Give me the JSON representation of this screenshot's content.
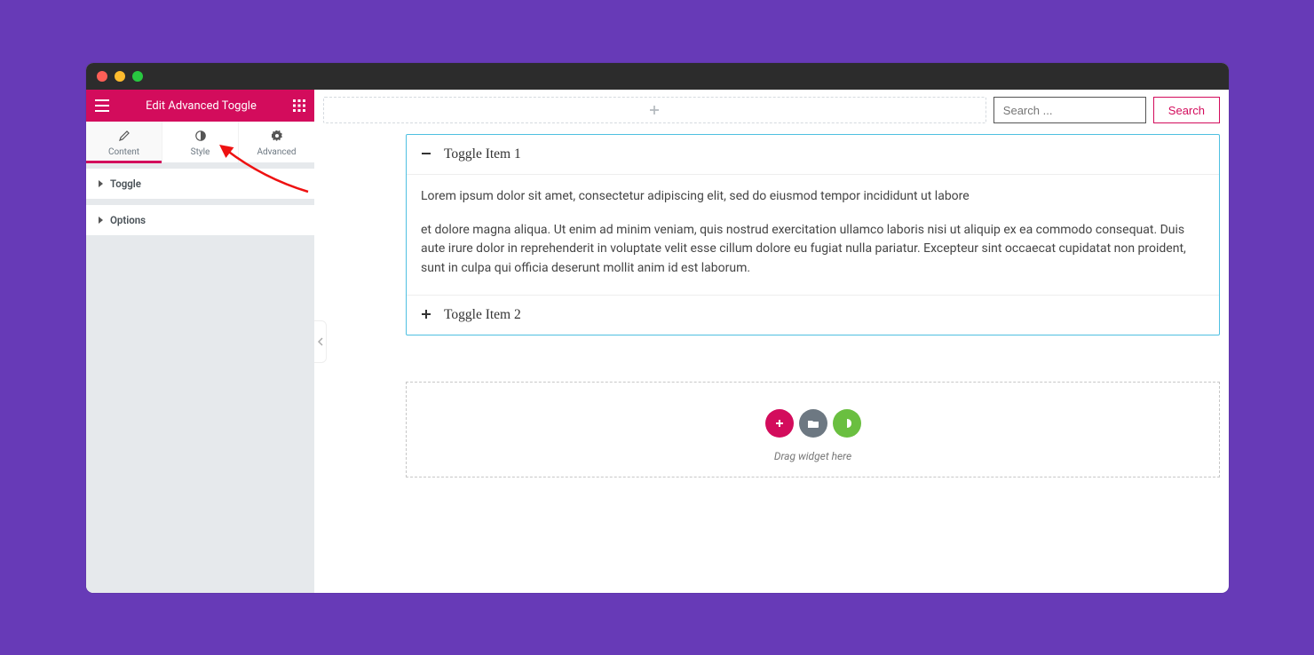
{
  "sidebar": {
    "title": "Edit Advanced Toggle",
    "tabs": [
      {
        "label": "Content",
        "active": true
      },
      {
        "label": "Style",
        "active": false
      },
      {
        "label": "Advanced",
        "active": false
      }
    ],
    "sections": [
      {
        "label": "Toggle"
      },
      {
        "label": "Options"
      }
    ]
  },
  "main": {
    "search": {
      "placeholder": "Search ...",
      "button": "Search"
    },
    "toggle": {
      "item1": {
        "title": "Toggle Item 1",
        "para1": "Lorem ipsum dolor sit amet, consectetur adipiscing elit, sed do eiusmod tempor incididunt ut labore",
        "para2": "et dolore magna aliqua. Ut enim ad minim veniam, quis nostrud exercitation ullamco laboris nisi ut aliquip ex ea commodo consequat. Duis aute irure dolor in reprehenderit in voluptate velit esse cillum dolore eu fugiat nulla pariatur. Excepteur sint occaecat cupidatat non proident, sunt in culpa qui officia deserunt mollit anim id est laborum."
      },
      "item2": {
        "title": "Toggle Item 2"
      }
    },
    "drop": {
      "hint": "Drag widget here"
    }
  },
  "colors": {
    "traffic": {
      "red": "#ff5f57",
      "yellow": "#febc2e",
      "green": "#28c840"
    }
  }
}
